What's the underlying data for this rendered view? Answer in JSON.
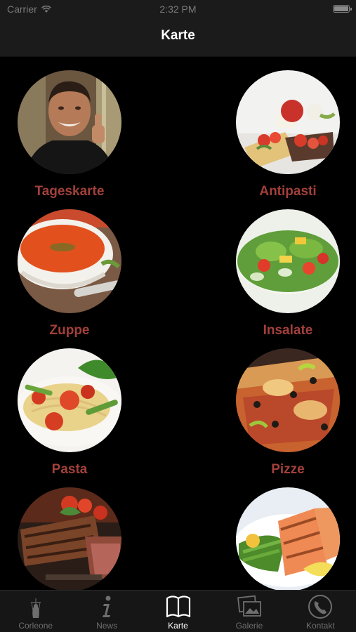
{
  "status_bar": {
    "carrier": "Carrier",
    "time": "2:32 PM",
    "battery_level": 1.0
  },
  "nav": {
    "title": "Karte"
  },
  "menu": {
    "items": [
      {
        "label": "Tageskarte",
        "icon": "chef-thumbs-up-photo"
      },
      {
        "label": "Antipasti",
        "icon": "bruschetta-photo"
      },
      {
        "label": "Zuppe",
        "icon": "tomato-soup-photo"
      },
      {
        "label": "Insalate",
        "icon": "salad-bowl-photo"
      },
      {
        "label": "Pasta",
        "icon": "spaghetti-tomato-photo"
      },
      {
        "label": "Pizze",
        "icon": "pizza-photo"
      },
      {
        "label": "",
        "icon": "steak-photo"
      },
      {
        "label": "",
        "icon": "grilled-salmon-photo"
      }
    ]
  },
  "tabs": [
    {
      "label": "Corleone",
      "icon": "godfather-puppeteer-icon",
      "active": false
    },
    {
      "label": "News",
      "icon": "info-icon",
      "active": false
    },
    {
      "label": "Karte",
      "icon": "open-book-icon",
      "active": true
    },
    {
      "label": "Galerie",
      "icon": "photos-icon",
      "active": false
    },
    {
      "label": "Kontakt",
      "icon": "phone-icon",
      "active": false
    }
  ],
  "colors": {
    "label_red": "#a2403b",
    "tab_active": "#ffffff",
    "tab_inactive": "#6e6e6e"
  }
}
